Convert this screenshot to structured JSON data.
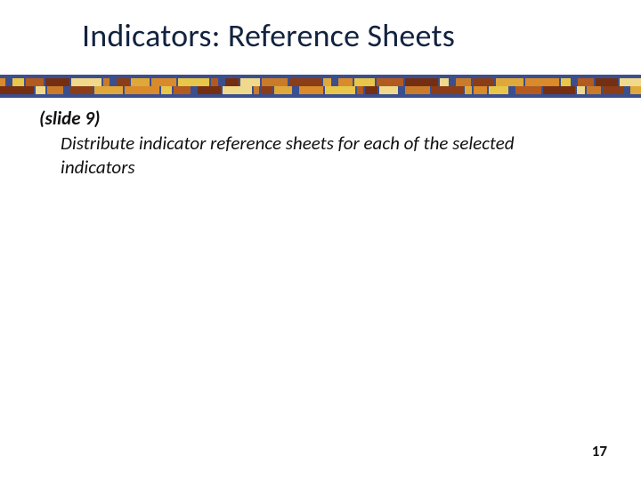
{
  "title": "Indicators: Reference Sheets",
  "slide_ref": "(slide 9)",
  "body": "Distribute indicator reference sheets for each of the selected indicators",
  "page_number": "17",
  "decor": {
    "bg": "#3b4f8f",
    "colors": [
      "#d98a2b",
      "#e7c64a",
      "#b35a1f",
      "#742f13",
      "#f0d98a",
      "#c97b2a",
      "#8a3d16",
      "#e0a83a"
    ]
  }
}
